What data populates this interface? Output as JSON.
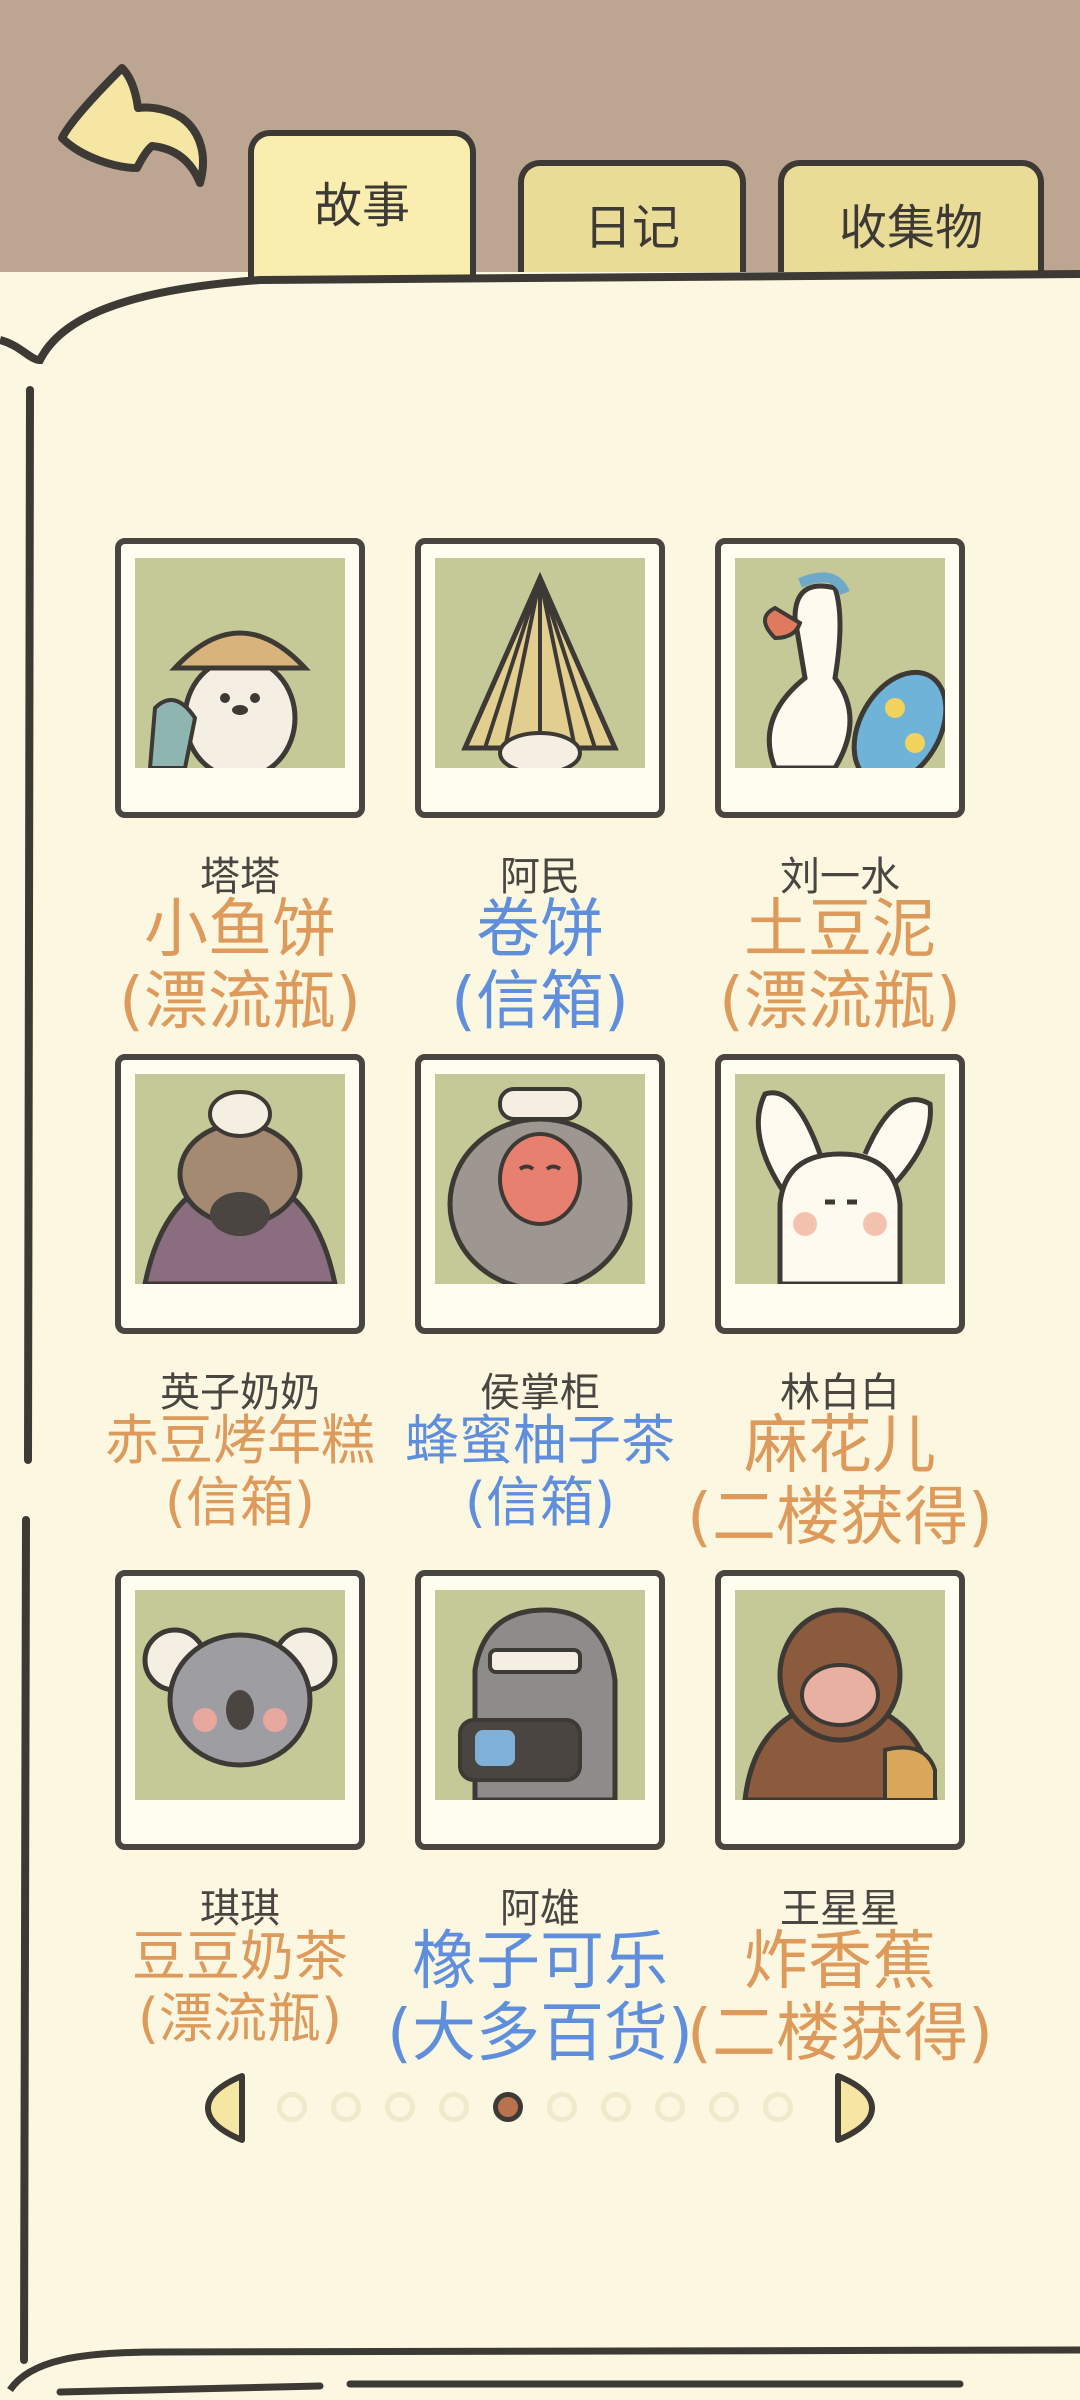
{
  "tabs": [
    {
      "label": "故事",
      "active": true
    },
    {
      "label": "日记",
      "active": false
    },
    {
      "label": "收集物",
      "active": false
    }
  ],
  "characters": [
    {
      "name": "塔塔",
      "item": "小鱼饼",
      "source": "(漂流瓶)",
      "color": "orange",
      "icon": "otter-straw-hat-portrait"
    },
    {
      "name": "阿民",
      "item": "卷饼",
      "source": "(信箱)",
      "color": "blue",
      "icon": "straw-cloak-portrait"
    },
    {
      "name": "刘一水",
      "item": "土豆泥",
      "source": "(漂流瓶)",
      "color": "orange",
      "icon": "goose-surfboard-portrait"
    },
    {
      "name": "英子奶奶",
      "item": "赤豆烤年糕",
      "source": "(信箱)",
      "color": "orange",
      "icon": "platypus-grandma-portrait"
    },
    {
      "name": "侯掌柜",
      "item": "蜂蜜柚子茶",
      "source": "(信箱)",
      "color": "blue",
      "icon": "snow-monkey-portrait"
    },
    {
      "name": "林白白",
      "item": "麻花儿",
      "source": "(二楼获得)",
      "color": "orange",
      "icon": "white-rabbit-portrait"
    },
    {
      "name": "琪琪",
      "item": "豆豆奶茶",
      "source": "(漂流瓶)",
      "color": "orange",
      "icon": "koala-portrait"
    },
    {
      "name": "阿雄",
      "item": "橡子可乐",
      "source": "(大多百货)",
      "color": "blue",
      "icon": "seal-camera-portrait"
    },
    {
      "name": "王星星",
      "item": "炸香蕉",
      "source": "(二楼获得)",
      "color": "orange",
      "icon": "gorilla-portrait"
    }
  ],
  "pagination": {
    "total": 10,
    "current": 5
  },
  "colors": {
    "orange": "#dd9a5b",
    "blue": "#5f8fdc",
    "frame_bg": "#c5c997",
    "page": "#fbf7e1",
    "top_bg": "#bca692"
  }
}
